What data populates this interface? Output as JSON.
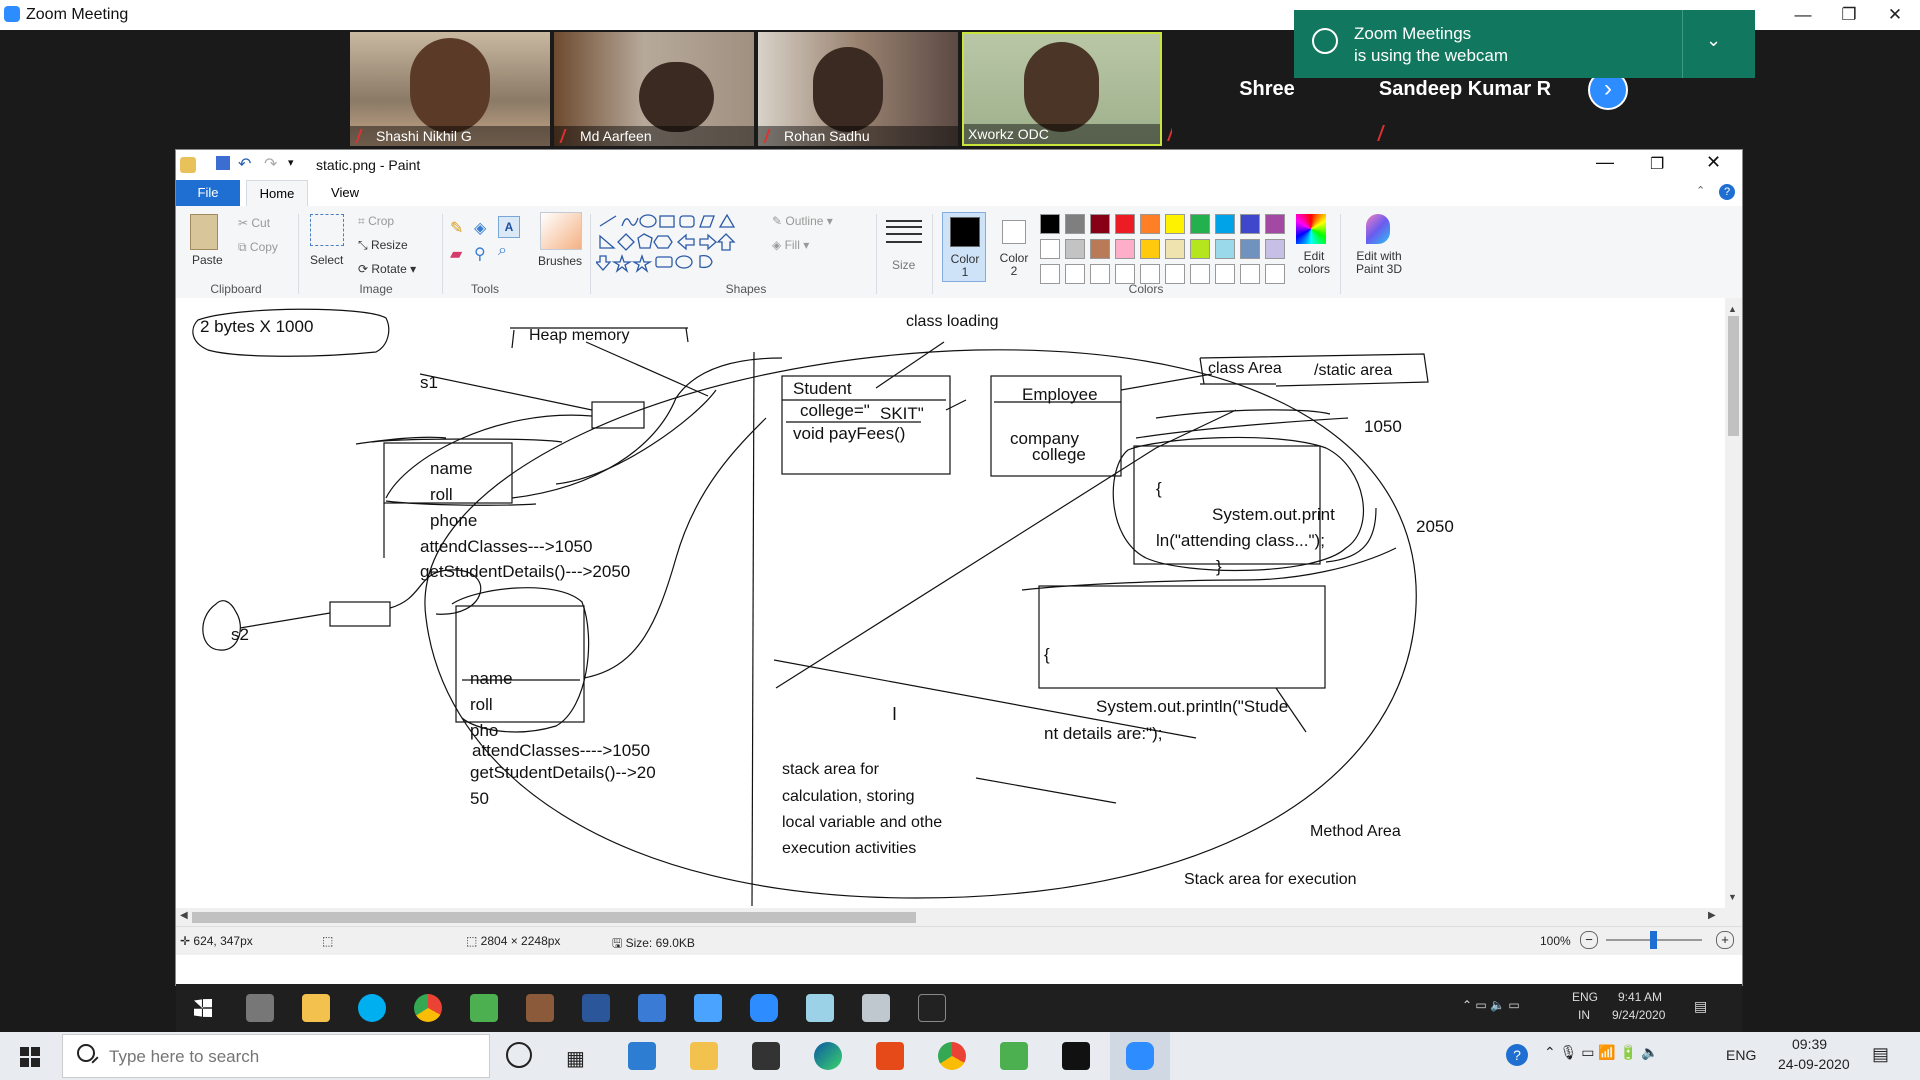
{
  "zoom": {
    "window_title": "Zoom Meeting",
    "participants": [
      {
        "name": "Shashi Nikhil G"
      },
      {
        "name": "Md Aarfeen"
      },
      {
        "name": "Rohan Sadhu"
      },
      {
        "name": "Xworkz ODC"
      }
    ],
    "name_tiles": [
      "Shree",
      "Sandeep Kumar R"
    ],
    "notification": {
      "line1": "Zoom Meetings",
      "line2": "is using the webcam"
    }
  },
  "paint": {
    "title": "static.png - Paint",
    "tabs": [
      "File",
      "Home",
      "View"
    ],
    "clipboard": {
      "paste": "Paste",
      "cut": "Cut",
      "copy": "Copy",
      "group": "Clipboard"
    },
    "image": {
      "select": "Select",
      "crop": "Crop",
      "resize": "Resize",
      "rotate": "Rotate",
      "group": "Image"
    },
    "tools": {
      "group": "Tools"
    },
    "brushes": "Brushes",
    "shapes": {
      "outline": "Outline",
      "fill": "Fill",
      "group": "Shapes"
    },
    "size": "Size",
    "color1": "Color 1",
    "color2": "Color 2",
    "colors_group": "Colors",
    "edit_colors": "Edit colors",
    "edit_paint3d": "Edit with Paint 3D",
    "palette": [
      "#000000",
      "#7f7f7f",
      "#880015",
      "#ed1c24",
      "#ff7f27",
      "#fff200",
      "#22b14c",
      "#00a2e8",
      "#3f48cc",
      "#a349a4",
      "#ffffff",
      "#c3c3c3",
      "#b97a57",
      "#ffaec9",
      "#ffc90e",
      "#efe4b0",
      "#b5e61d",
      "#99d9ea",
      "#7092be",
      "#c8bfe7"
    ],
    "status": {
      "cursor": "624, 347px",
      "dimensions": "2804 × 2248px",
      "size": "Size: 69.0KB",
      "zoom": "100%"
    }
  },
  "drawing": {
    "bytes": "2 bytes X 1000",
    "heap": "Heap memory",
    "class_loading": "class loading",
    "class_area": "class Area",
    "static_area": "/static area",
    "s1": "s1",
    "s2": "s2",
    "student": "Student",
    "college": "college=\"",
    "skit": "SKIT\"",
    "payfees": "void payFees()",
    "employee": "Employee",
    "company": "company",
    "emp_college": "college",
    "addr1050": "1050",
    "addr2050": "2050",
    "obj1": [
      "name",
      "roll",
      "phone",
      "attendClasses--->1050",
      "getStudentDetails()--->2050"
    ],
    "obj2": [
      "name",
      "roll",
      "pho",
      "attendClasses---->1050",
      "getStudentDetails()-->20",
      "50"
    ],
    "method1": [
      "{",
      "System.out.print",
      "ln(\"attending class...\");",
      "}"
    ],
    "method2": [
      "{",
      "System.out.println(\"Stude",
      "nt details are:\");"
    ],
    "stack_note": [
      "stack area for",
      "calculation, storing",
      "local variable and othe",
      "execution activities"
    ],
    "method_area": "Method Area",
    "stack_exec": "Stack area  for execution"
  },
  "taskbar": {
    "inner_time": "9:41 AM",
    "inner_date": "9/24/2020",
    "inner_lang": "ENG",
    "inner_region": "IN",
    "search_placeholder": "Type here to search",
    "time": "09:39",
    "date": "24-09-2020",
    "lang": "ENG"
  }
}
